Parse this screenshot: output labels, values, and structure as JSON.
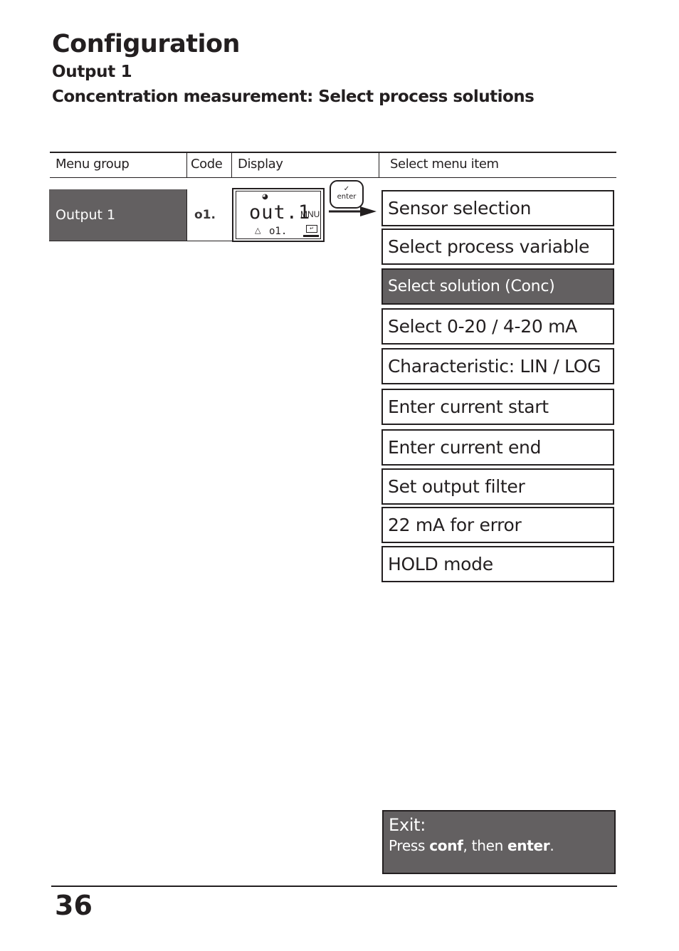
{
  "header": {
    "title": "Configuration",
    "subtitle": "Output 1",
    "section": "Concentration measurement: Select process solutions"
  },
  "table": {
    "columns": [
      "Menu group",
      "Code",
      "Display",
      "Select menu item"
    ],
    "row": {
      "menu_group": "Output 1",
      "code": "o1.",
      "display": {
        "main": "out.1",
        "mode": "MNU",
        "sub": "o1.",
        "icons": [
          "clock-icon",
          "hold-warning-icon",
          "enter-indicator-icon"
        ]
      }
    },
    "enter_key": {
      "check": "✓",
      "label": "enter"
    }
  },
  "menu_items": [
    {
      "label": "Sensor selection",
      "active": false
    },
    {
      "label": "Select process variable",
      "active": false
    },
    {
      "label": "Select solution (Conc)",
      "active": true
    },
    {
      "label": "Select 0-20 / 4-20 mA",
      "active": false
    },
    {
      "label": "Characteristic: LIN / LOG",
      "active": false
    },
    {
      "label": "Enter current start",
      "active": false
    },
    {
      "label": "Enter current end",
      "active": false
    },
    {
      "label": "Set output filter",
      "active": false
    },
    {
      "label": "22 mA for error",
      "active": false
    },
    {
      "label": "HOLD mode",
      "active": false
    }
  ],
  "exit": {
    "title": "Exit:",
    "press": "Press ",
    "key1": "conf",
    "then": ", then ",
    "key2": "enter",
    "end": "."
  },
  "footer": {
    "page_number": "36"
  },
  "colors": {
    "highlight": "#636061",
    "text": "#231f20"
  }
}
